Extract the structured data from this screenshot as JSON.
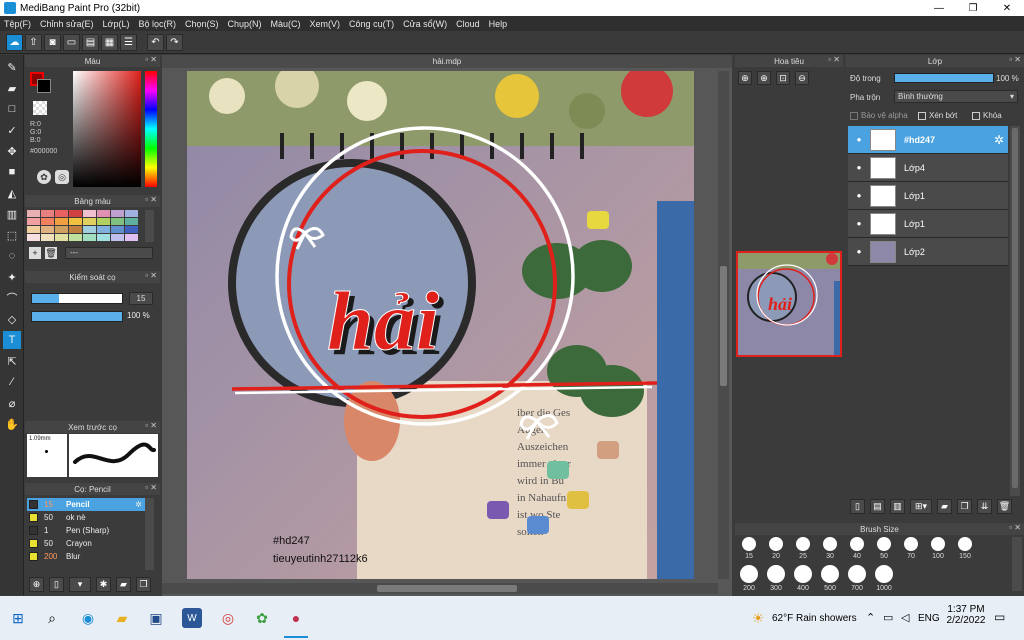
{
  "window": {
    "title": "MediBang Paint Pro (32bit)",
    "minimize": "—",
    "maximize": "❐",
    "close": "✕"
  },
  "menu": [
    "Tệp(F)",
    "Chỉnh sửa(E)",
    "Lớp(L)",
    "Bộ lọc(R)",
    "Chọn(S)",
    "Chụp(N)",
    "Màu(C)",
    "Xem(V)",
    "Công cụ(T)",
    "Cửa sổ(W)",
    "Cloud",
    "Help"
  ],
  "color_panel": {
    "title": "Màu",
    "r": "R:0",
    "g": "G:0",
    "b": "B:0",
    "hex": "#000000"
  },
  "palette_panel": {
    "title": "Bảng màu",
    "more": "---"
  },
  "brush_control": {
    "title": "Kiểm soát cọ",
    "size": "15",
    "opacity": "100 %"
  },
  "brush_preview": {
    "title": "Xem trước cọ",
    "size_label": "1.09mm"
  },
  "brush_list": {
    "title": "Cọ: Pencil",
    "items": [
      {
        "size": "15",
        "name": "Pencil",
        "color": "#333333",
        "selected": true
      },
      {
        "size": "50",
        "name": "ok nè",
        "color": "#e8e030",
        "selected": false
      },
      {
        "size": "1",
        "name": "Pen (Sharp)",
        "color": "#333333",
        "selected": false
      },
      {
        "size": "50",
        "name": "Crayon",
        "color": "#e8e030",
        "selected": false
      },
      {
        "size": "200",
        "name": "Blur",
        "color": "#e8e030",
        "selected": false
      }
    ]
  },
  "canvas": {
    "filename": "hải.mdp",
    "art_text": "hải",
    "sign1": "#hd247",
    "sign2": "tieuyeutinh27112k6"
  },
  "navigator": {
    "title": "Hoa tiêu"
  },
  "layers": {
    "title": "Lớp",
    "opacity_label": "Độ trong",
    "opacity_value": "100 %",
    "blend_label": "Pha trộn",
    "blend_value": "Bình thường",
    "protect_alpha": "Bảo vệ alpha",
    "clipping": "Xén bớt",
    "lock": "Khóa",
    "items": [
      {
        "name": "#hd247",
        "selected": true
      },
      {
        "name": "Lớp4",
        "selected": false
      },
      {
        "name": "Lớp1",
        "selected": false
      },
      {
        "name": "Lớp1",
        "selected": false
      },
      {
        "name": "Lớp2",
        "selected": false
      }
    ]
  },
  "brush_size": {
    "title": "Brush Size",
    "row1": [
      "15",
      "20",
      "25",
      "30",
      "40",
      "50",
      "70",
      "100",
      "150"
    ],
    "row2": [
      "200",
      "300",
      "400",
      "500",
      "700",
      "1000"
    ]
  },
  "taskbar": {
    "weather": "62°F  Rain showers",
    "lang": "ENG",
    "time": "1:37 PM",
    "date": "2/2/2022"
  }
}
